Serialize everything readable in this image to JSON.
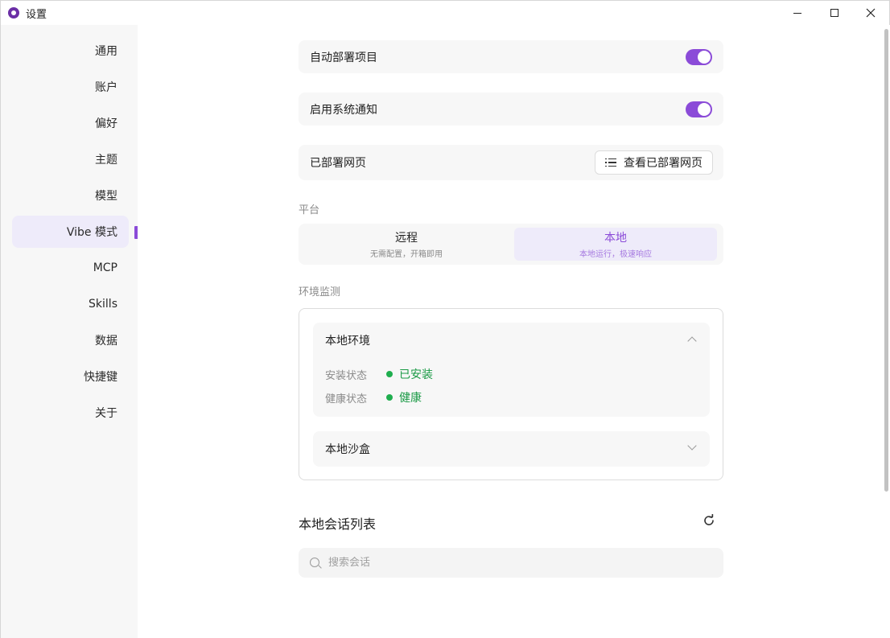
{
  "window": {
    "title": "设置",
    "controls": [
      "minimize-icon",
      "maximize-icon",
      "close-icon"
    ]
  },
  "sidebar": {
    "items": [
      {
        "label": "通用"
      },
      {
        "label": "账户"
      },
      {
        "label": "偏好"
      },
      {
        "label": "主题"
      },
      {
        "label": "模型"
      },
      {
        "label": "Vibe 模式",
        "active": true
      },
      {
        "label": "MCP"
      },
      {
        "label": "Skills"
      },
      {
        "label": "数据"
      },
      {
        "label": "快捷键"
      },
      {
        "label": "关于"
      }
    ]
  },
  "settings": {
    "auto_deploy": {
      "label": "自动部署项目",
      "enabled": true
    },
    "system_notify": {
      "label": "启用系统通知",
      "enabled": true
    },
    "deployed_pages": {
      "label": "已部署网页",
      "button_label": "查看已部署网页",
      "button_icon": "list-icon"
    }
  },
  "platform": {
    "section_label": "平台",
    "options": [
      {
        "title": "远程",
        "subtitle": "无需配置，开箱即用",
        "selected": false
      },
      {
        "title": "本地",
        "subtitle": "本地运行，极速响应",
        "selected": true
      }
    ]
  },
  "env_monitor": {
    "section_label": "环境监测",
    "local_env": {
      "title": "本地环境",
      "expanded": true,
      "install_status_label": "安装状态",
      "install_status_value": "已安装",
      "health_status_label": "健康状态",
      "health_status_value": "健康"
    },
    "local_sandbox": {
      "title": "本地沙盒",
      "expanded": false
    }
  },
  "sessions": {
    "title": "本地会话列表",
    "refresh_icon": "refresh-icon",
    "search_placeholder": "搜索会话"
  },
  "colors": {
    "accent": "#8b4bd8",
    "accent_bg": "#eeebfa",
    "success": "#1a9a45"
  }
}
